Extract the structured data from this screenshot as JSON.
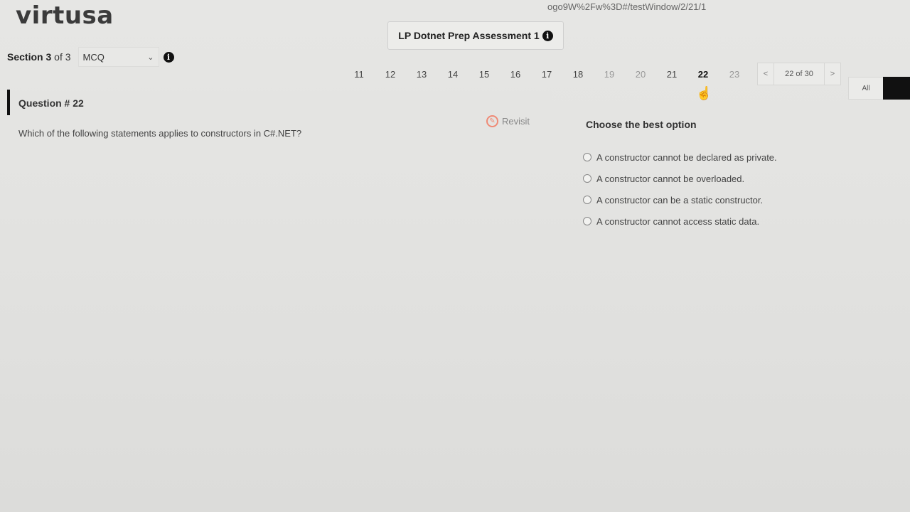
{
  "url_fragment": "ogo9W%2Fw%3D#/testWindow/2/21/1",
  "logo": "virtusa",
  "test_title": "LP Dotnet Prep Assessment 1",
  "section": {
    "label_prefix": "Section",
    "current": "3",
    "of_label": "of 3",
    "selected": "MCQ"
  },
  "question_nav": {
    "numbers": [
      "11",
      "12",
      "13",
      "14",
      "15",
      "16",
      "17",
      "18",
      "19",
      "20",
      "21",
      "22",
      "23"
    ],
    "current": "22",
    "prev": "<",
    "next": ">",
    "position_label": "22 of 30",
    "all_label": "All"
  },
  "question": {
    "label": "Question # 22",
    "text": "Which of the following statements applies to constructors in C#.NET?",
    "revisit_label": "Revisit"
  },
  "answer": {
    "header": "Choose the best option",
    "options": [
      "A constructor cannot be declared as private.",
      "A constructor cannot be overloaded.",
      "A constructor can be a static constructor.",
      "A constructor cannot access static data."
    ]
  },
  "colors": {
    "accent_revisit": "#ef8a76",
    "active_bar": "#111111"
  }
}
